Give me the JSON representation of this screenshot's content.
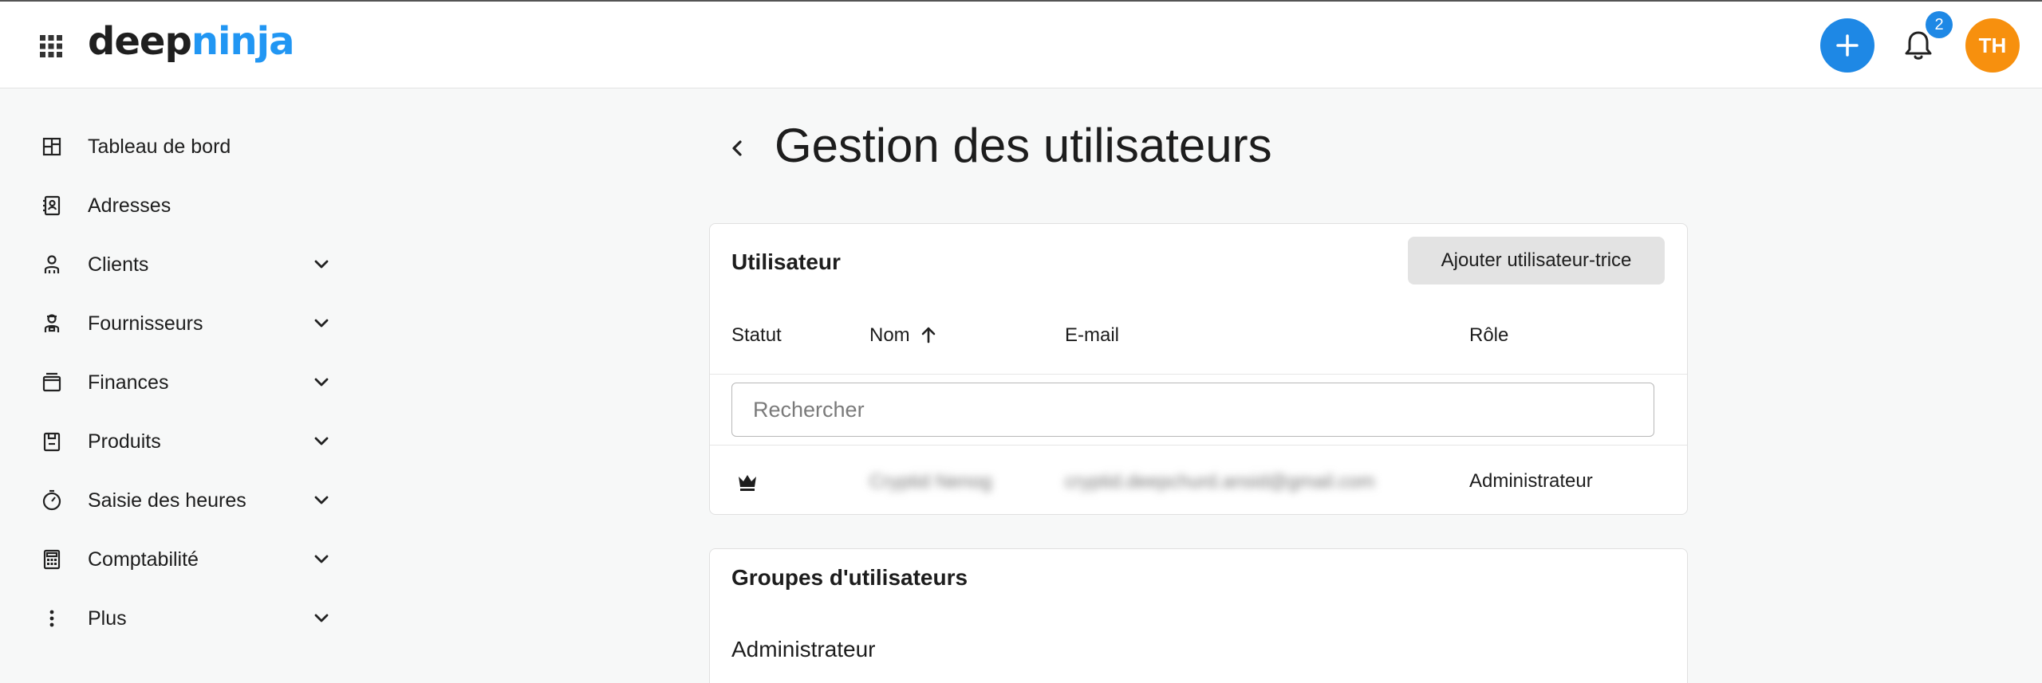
{
  "header": {
    "logo_part1": "deep",
    "logo_part2": "ninja",
    "notification_count": "2",
    "avatar_initials": "TH",
    "icons": [
      "apps-grid-icon",
      "plus-icon",
      "bell-icon"
    ],
    "colors": {
      "accent": "#1e88e5",
      "avatar_bg": "#f7900e",
      "logo_accent": "#2196f3"
    }
  },
  "sidebar": {
    "items": [
      {
        "label": "Tableau de bord",
        "icon": "dashboard-icon",
        "expandable": false
      },
      {
        "label": "Adresses",
        "icon": "address-book-icon",
        "expandable": false
      },
      {
        "label": "Clients",
        "icon": "clients-icon",
        "expandable": true
      },
      {
        "label": "Fournisseurs",
        "icon": "suppliers-icon",
        "expandable": true
      },
      {
        "label": "Finances",
        "icon": "wallet-icon",
        "expandable": true
      },
      {
        "label": "Produits",
        "icon": "product-icon",
        "expandable": true
      },
      {
        "label": "Saisie des heures",
        "icon": "timer-icon",
        "expandable": true
      },
      {
        "label": "Comptabilité",
        "icon": "calculator-icon",
        "expandable": true
      },
      {
        "label": "Plus",
        "icon": "more-vertical-icon",
        "expandable": true
      }
    ]
  },
  "page": {
    "title": "Gestion des utilisateurs"
  },
  "users_card": {
    "title": "Utilisateur",
    "add_button_label": "Ajouter utilisateur-trice",
    "columns": {
      "status": "Statut",
      "name": "Nom",
      "email": "E-mail",
      "role": "Rôle"
    },
    "search_placeholder": "Rechercher",
    "rows": [
      {
        "status_icon": "crown-icon",
        "name": "Cryptid Nenog",
        "email": "cryptid.deepchurd.ansid@gmail.com",
        "role": "Administrateur"
      }
    ]
  },
  "groups_card": {
    "title": "Groupes d'utilisateurs",
    "items": [
      "Administrateur"
    ]
  }
}
